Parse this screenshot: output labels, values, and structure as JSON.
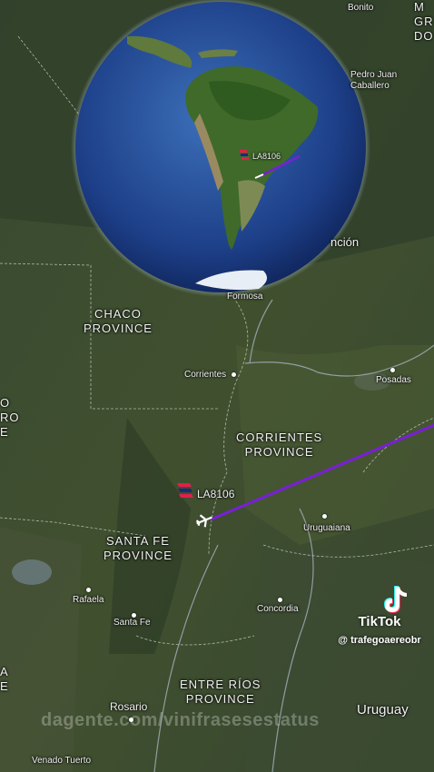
{
  "flight": {
    "callsign": "LA8106",
    "route_color": "#7a1fd6"
  },
  "provinces": {
    "chaco": "CHACO\nPROVINCE",
    "corrientes": "CORRIENTES\nPROVINCE",
    "santa_fe": "SANTA FE\nPROVINCE",
    "entre_rios": "ENTRE RÍOS\nPROVINCE"
  },
  "cities": {
    "bonito": "Bonito",
    "pedro_juan": "Pedro Juan\nCaballero",
    "asuncion": "nción",
    "formosa": "Formosa",
    "corrientes": "Corrientes",
    "posadas": "Posadas",
    "uruguaiana": "Uruguaiana",
    "rafaela": "Rafaela",
    "santa_fe": "Santa Fe",
    "concordia": "Concordia",
    "rosario": "Rosario",
    "venado_tuerto": "Venado Tuerto",
    "uruguay": "Uruguay"
  },
  "edge_labels": {
    "top_right": "M\nGR\nDO",
    "left_mid": "O\nRO\nE",
    "left_low": "A\nE"
  },
  "inset": {
    "callsign": "LA8106"
  },
  "tiktok": {
    "brand": "TikTok",
    "handle": "@ trafegoaereobr"
  },
  "watermark": "dagente.com/vinifrasesestatus"
}
